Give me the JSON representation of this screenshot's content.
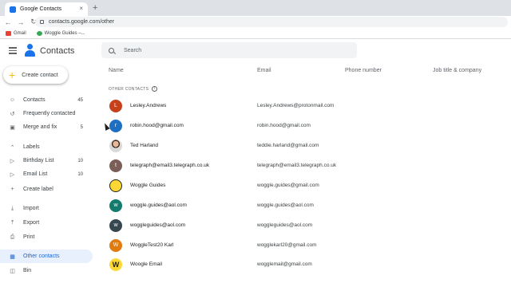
{
  "browser": {
    "tab_title": "Google Contacts",
    "new_tab": "+",
    "close": "×",
    "url": "contacts.google.com/other",
    "nav": {
      "back": "←",
      "forward": "→",
      "reload": "↻"
    },
    "bookmarks": [
      {
        "label": "Gmail",
        "icon": "gmail-icon",
        "color": "#ea4335"
      },
      {
        "label": "Woggle Guides –...",
        "icon": "woggle-icon",
        "color": "#34a853"
      }
    ]
  },
  "app": {
    "title": "Contacts",
    "search_placeholder": "Search",
    "create_label": "Create contact",
    "accent": "#1a73e8"
  },
  "sidebar": {
    "items": [
      {
        "label": "Contacts",
        "count": "45",
        "icon": "person-icon"
      },
      {
        "label": "Frequently contacted",
        "count": "",
        "icon": "history-icon"
      },
      {
        "label": "Merge and fix",
        "count": "5",
        "icon": "merge-icon"
      },
      {
        "label": "Labels",
        "count": "",
        "icon": "chevron-up-icon"
      },
      {
        "label": "Birthday List",
        "count": "10",
        "icon": "label-icon"
      },
      {
        "label": "Email List",
        "count": "10",
        "icon": "label-icon"
      },
      {
        "label": "Create label",
        "count": "",
        "icon": "plus-icon"
      },
      {
        "label": "Import",
        "count": "",
        "icon": "import-icon"
      },
      {
        "label": "Export",
        "count": "",
        "icon": "export-icon"
      },
      {
        "label": "Print",
        "count": "",
        "icon": "print-icon"
      },
      {
        "label": "Other contacts",
        "count": "",
        "icon": "other-contacts-icon",
        "active": true
      },
      {
        "label": "Bin",
        "count": "",
        "icon": "trash-icon"
      }
    ]
  },
  "table": {
    "columns": [
      "Name",
      "Email",
      "Phone number",
      "Job title & company"
    ],
    "section_label": "OTHER CONTACTS",
    "rows": [
      {
        "initial": "L",
        "name": "Lesley.Andrews",
        "email": "Lesley.Andrews@protonmail.com",
        "color": "#c5401b"
      },
      {
        "initial": "r",
        "name": "robin.hood@gmail.com",
        "email": "robin.hood@gmail.com",
        "color": "#1e6fc2"
      },
      {
        "initial": "",
        "name": "Ted Harland",
        "email": "teddie.harland@gmail.com",
        "color": "#e0e0e0",
        "photo": true
      },
      {
        "initial": "t",
        "name": "telegraph@email3.telegraph.co.uk",
        "email": "telegraph@email3.telegraph.co.uk",
        "color": "#7b5e57"
      },
      {
        "initial": "",
        "name": "Woggle Guides",
        "email": "woggle.guides@gmail.com",
        "color": "#fdd835",
        "logo": true
      },
      {
        "initial": "w",
        "name": "woggle.guides@aol.com",
        "email": "woggle.guides@aol.com",
        "color": "#137a6e"
      },
      {
        "initial": "w",
        "name": "woggleguides@aol.com",
        "email": "woggleguides@aol.com",
        "color": "#37474f"
      },
      {
        "initial": "W",
        "name": "WoggleTest20 Karl",
        "email": "wogglekarl20@gmail.com",
        "color": "#e07b0f"
      },
      {
        "initial": "",
        "name": "Woogle Email",
        "email": "wogglemail@gmail.com",
        "color": "#fdd835",
        "logo": true
      }
    ]
  }
}
